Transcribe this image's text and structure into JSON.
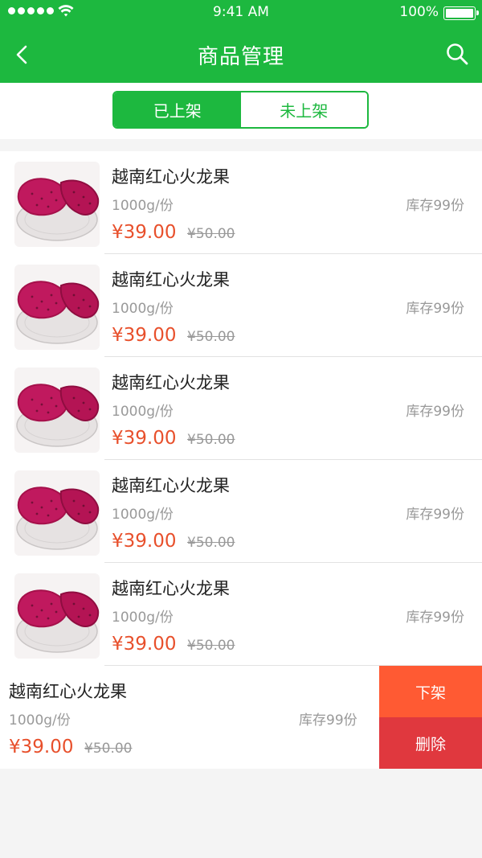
{
  "status_bar": {
    "time": "9:41 AM",
    "battery": "100%"
  },
  "nav": {
    "title": "商品管理",
    "back_icon": "chevron-left-icon",
    "search_icon": "search-icon"
  },
  "tabs": [
    {
      "label": "已上架",
      "active": true
    },
    {
      "label": "未上架",
      "active": false
    }
  ],
  "colors": {
    "brand_green": "#1db83f",
    "price_red": "#e8502c",
    "offshelf_orange": "#ff5a33",
    "delete_red": "#e0383e"
  },
  "products": [
    {
      "name": "越南红心火龙果",
      "spec": "1000g/份",
      "stock": "库存99份",
      "price": "¥39.00",
      "old_price": "¥50.00"
    },
    {
      "name": "越南红心火龙果",
      "spec": "1000g/份",
      "stock": "库存99份",
      "price": "¥39.00",
      "old_price": "¥50.00"
    },
    {
      "name": "越南红心火龙果",
      "spec": "1000g/份",
      "stock": "库存99份",
      "price": "¥39.00",
      "old_price": "¥50.00"
    },
    {
      "name": "越南红心火龙果",
      "spec": "1000g/份",
      "stock": "库存99份",
      "price": "¥39.00",
      "old_price": "¥50.00"
    },
    {
      "name": "越南红心火龙果",
      "spec": "1000g/份",
      "stock": "库存99份",
      "price": "¥39.00",
      "old_price": "¥50.00"
    }
  ],
  "swiped_product": {
    "name": "越南红心火龙果",
    "spec": "1000g/份",
    "stock": "库存99份",
    "price": "¥39.00",
    "old_price": "¥50.00",
    "off_shelf_label": "下架",
    "delete_label": "删除"
  }
}
